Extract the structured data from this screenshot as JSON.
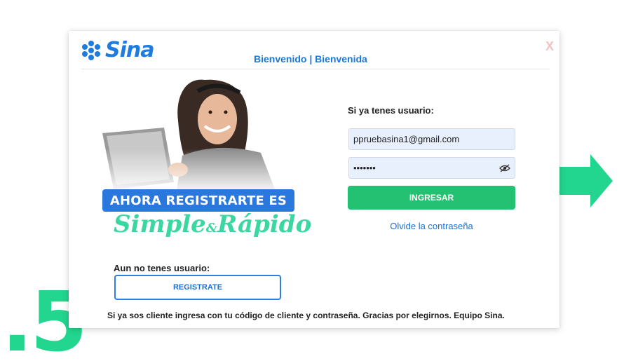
{
  "brand": {
    "name": "Sina",
    "accent": "#1e7be0",
    "green": "#22d68f"
  },
  "step": {
    "number": ".5"
  },
  "modal": {
    "title": "Bienvenido | Bienvenida",
    "close_label": "X",
    "close_icon": "close-icon"
  },
  "promo": {
    "banner": "AHORA REGISTRARTE ES",
    "script_1": "Simple",
    "script_amp": "&",
    "script_2": "Rápido"
  },
  "register": {
    "label": "Aun no tenes usuario:",
    "button": "REGISTRATE"
  },
  "login": {
    "label": "Si ya tenes usuario:",
    "email_value": "ppruebasina1@gmail.com",
    "password_value": "•••••••",
    "eye_icon": "eye-icon",
    "submit": "INGRESAR",
    "forgot": "Olvide la contraseña"
  },
  "footer": {
    "text": "Si ya sos cliente ingresa con tu código de cliente y contraseña. Gracias por elegirnos. Equipo Sina."
  },
  "arrow_icon": "arrow-right-icon"
}
